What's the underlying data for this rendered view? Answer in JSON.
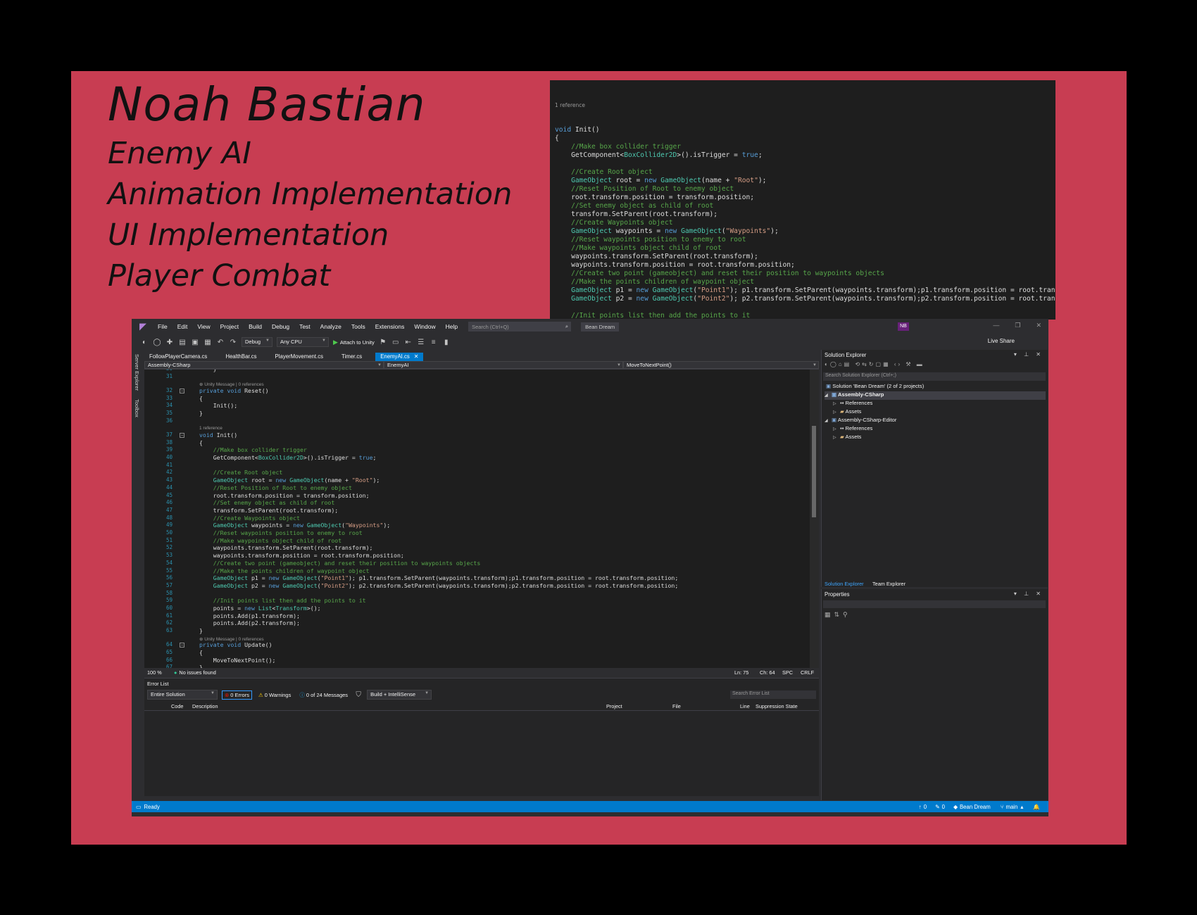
{
  "credits": {
    "name": "Noah Bastian",
    "roles": [
      "Enemy AI",
      "Animation Implementation",
      "UI Implementation",
      "Player Combat"
    ]
  },
  "code_panel": {
    "reference": "1 reference",
    "lines": [
      [
        [
          "k",
          "void"
        ],
        [
          "p",
          " Init()"
        ]
      ],
      [
        [
          "p",
          "{"
        ]
      ],
      [
        [
          "c",
          "    //Make box collider trigger"
        ]
      ],
      [
        [
          "p",
          "    GetComponent<"
        ],
        [
          "t",
          "BoxCollider2D"
        ],
        [
          "p",
          ">().isTrigger = "
        ],
        [
          "k",
          "true"
        ],
        [
          "p",
          ";"
        ]
      ],
      [
        [
          "p",
          ""
        ]
      ],
      [
        [
          "c",
          "    //Create Root object"
        ]
      ],
      [
        [
          "t",
          "    GameObject"
        ],
        [
          "p",
          " root = "
        ],
        [
          "k",
          "new"
        ],
        [
          "p",
          " "
        ],
        [
          "t",
          "GameObject"
        ],
        [
          "p",
          "(name + "
        ],
        [
          "s",
          "\"Root\""
        ],
        [
          "p",
          ");"
        ]
      ],
      [
        [
          "c",
          "    //Reset Position of Root to enemy object"
        ]
      ],
      [
        [
          "p",
          "    root.transform.position = transform.position;"
        ]
      ],
      [
        [
          "c",
          "    //Set enemy object as child of root"
        ]
      ],
      [
        [
          "p",
          "    transform.SetParent(root.transform);"
        ]
      ],
      [
        [
          "c",
          "    //Create Waypoints object"
        ]
      ],
      [
        [
          "t",
          "    GameObject"
        ],
        [
          "p",
          " waypoints = "
        ],
        [
          "k",
          "new"
        ],
        [
          "p",
          " "
        ],
        [
          "t",
          "GameObject"
        ],
        [
          "p",
          "("
        ],
        [
          "s",
          "\"Waypoints\""
        ],
        [
          "p",
          ");"
        ]
      ],
      [
        [
          "c",
          "    //Reset waypoints position to enemy to root"
        ]
      ],
      [
        [
          "c",
          "    //Make waypoints object child of root"
        ]
      ],
      [
        [
          "p",
          "    waypoints.transform.SetParent(root.transform);"
        ]
      ],
      [
        [
          "p",
          "    waypoints.transform.position = root.transform.position;"
        ]
      ],
      [
        [
          "c",
          "    //Create two point (gameobject) and reset their position to waypoints objects"
        ]
      ],
      [
        [
          "c",
          "    //Make the points children of waypoint object"
        ]
      ],
      [
        [
          "t",
          "    GameObject"
        ],
        [
          "p",
          " p1 = "
        ],
        [
          "k",
          "new"
        ],
        [
          "p",
          " "
        ],
        [
          "t",
          "GameObject"
        ],
        [
          "p",
          "("
        ],
        [
          "s",
          "\"Point1\""
        ],
        [
          "p",
          "); p1.transform.SetParent(waypoints.transform);p1.transform.position = root.transform.position;"
        ]
      ],
      [
        [
          "t",
          "    GameObject"
        ],
        [
          "p",
          " p2 = "
        ],
        [
          "k",
          "new"
        ],
        [
          "p",
          " "
        ],
        [
          "t",
          "GameObject"
        ],
        [
          "p",
          "("
        ],
        [
          "s",
          "\"Point2\""
        ],
        [
          "p",
          "); p2.transform.SetParent(waypoints.transform);p2.transform.position = root.transform.position;"
        ]
      ],
      [
        [
          "p",
          ""
        ]
      ],
      [
        [
          "c",
          "    //Init points list then add the points to it"
        ]
      ],
      [
        [
          "p",
          "    points = "
        ],
        [
          "k",
          "new"
        ],
        [
          "p",
          " "
        ],
        [
          "t",
          "List"
        ],
        [
          "p",
          "<"
        ],
        [
          "t",
          "Transform"
        ],
        [
          "p",
          ">();"
        ]
      ],
      [
        [
          "p",
          "    points.Add(p1.transform);"
        ]
      ],
      [
        [
          "p",
          "    points.Add(p2.transform);"
        ]
      ],
      [
        [
          "p",
          "}"
        ]
      ]
    ]
  },
  "vs": {
    "menu": [
      "File",
      "Edit",
      "View",
      "Project",
      "Build",
      "Debug",
      "Test",
      "Analyze",
      "Tools",
      "Extensions",
      "Window",
      "Help"
    ],
    "search_placeholder": "Search (Ctrl+Q)",
    "solution_name": "Bean Dream",
    "user_initials": "NB",
    "toolbar": {
      "config": "Debug",
      "platform": "Any CPU",
      "attach": "Attach to Unity",
      "live_share": "Live Share"
    },
    "side_tabs": [
      "Server Explorer",
      "Toolbox"
    ],
    "doc_tabs": [
      "FollowPlayerCamera.cs",
      "HealthBar.cs",
      "PlayerMovement.cs",
      "Timer.cs",
      "EnemyAI.cs"
    ],
    "nav": {
      "project": "Assembly-CSharp",
      "class": "EnemyAI",
      "member": "MoveToNextPoint()"
    },
    "editor_lines": [
      {
        "n": "30",
        "t": [
          [
            "p",
            "    }"
          ]
        ]
      },
      {
        "n": "31",
        "t": [
          [
            "p",
            ""
          ]
        ]
      },
      {
        "lens": "⊕ Unity Message | 0 references"
      },
      {
        "n": "32",
        "t": [
          [
            "k",
            "private"
          ],
          [
            "p",
            " "
          ],
          [
            "k",
            "void"
          ],
          [
            "p",
            " Reset()"
          ]
        ]
      },
      {
        "n": "33",
        "t": [
          [
            "p",
            "{"
          ]
        ]
      },
      {
        "n": "34",
        "t": [
          [
            "p",
            "    Init();"
          ]
        ]
      },
      {
        "n": "35",
        "t": [
          [
            "p",
            "}"
          ]
        ]
      },
      {
        "n": "36",
        "t": [
          [
            "p",
            ""
          ]
        ]
      },
      {
        "lens": "1 reference"
      },
      {
        "n": "37",
        "t": [
          [
            "k",
            "void"
          ],
          [
            "p",
            " Init()"
          ]
        ]
      },
      {
        "n": "38",
        "t": [
          [
            "p",
            "{"
          ]
        ]
      },
      {
        "n": "39",
        "t": [
          [
            "c",
            "    //Make box collider trigger"
          ]
        ]
      },
      {
        "n": "40",
        "t": [
          [
            "p",
            "    GetComponent<"
          ],
          [
            "t",
            "BoxCollider2D"
          ],
          [
            "p",
            ">().isTrigger = "
          ],
          [
            "k",
            "true"
          ],
          [
            "p",
            ";"
          ]
        ]
      },
      {
        "n": "41",
        "t": [
          [
            "p",
            ""
          ]
        ]
      },
      {
        "n": "42",
        "t": [
          [
            "c",
            "    //Create Root object"
          ]
        ]
      },
      {
        "n": "43",
        "t": [
          [
            "t",
            "    GameObject"
          ],
          [
            "p",
            " root = "
          ],
          [
            "k",
            "new"
          ],
          [
            "p",
            " "
          ],
          [
            "t",
            "GameObject"
          ],
          [
            "p",
            "(name + "
          ],
          [
            "s",
            "\"Root\""
          ],
          [
            "p",
            ");"
          ]
        ]
      },
      {
        "n": "44",
        "t": [
          [
            "c",
            "    //Reset Position of Root to enemy object"
          ]
        ]
      },
      {
        "n": "45",
        "t": [
          [
            "p",
            "    root.transform.position = transform.position;"
          ]
        ]
      },
      {
        "n": "46",
        "t": [
          [
            "c",
            "    //Set enemy object as child of root"
          ]
        ]
      },
      {
        "n": "47",
        "t": [
          [
            "p",
            "    transform.SetParent(root.transform);"
          ]
        ]
      },
      {
        "n": "48",
        "t": [
          [
            "c",
            "    //Create Waypoints object"
          ]
        ]
      },
      {
        "n": "49",
        "t": [
          [
            "t",
            "    GameObject"
          ],
          [
            "p",
            " waypoints = "
          ],
          [
            "k",
            "new"
          ],
          [
            "p",
            " "
          ],
          [
            "t",
            "GameObject"
          ],
          [
            "p",
            "("
          ],
          [
            "s",
            "\"Waypoints\""
          ],
          [
            "p",
            ");"
          ]
        ]
      },
      {
        "n": "50",
        "t": [
          [
            "c",
            "    //Reset waypoints position to enemy to root"
          ]
        ]
      },
      {
        "n": "51",
        "t": [
          [
            "c",
            "    //Make waypoints object child of root"
          ]
        ]
      },
      {
        "n": "52",
        "t": [
          [
            "p",
            "    waypoints.transform.SetParent(root.transform);"
          ]
        ]
      },
      {
        "n": "53",
        "t": [
          [
            "p",
            "    waypoints.transform.position = root.transform.position;"
          ]
        ]
      },
      {
        "n": "54",
        "t": [
          [
            "c",
            "    //Create two point (gameobject) and reset their position to waypoints objects"
          ]
        ]
      },
      {
        "n": "55",
        "t": [
          [
            "c",
            "    //Make the points children of waypoint object"
          ]
        ]
      },
      {
        "n": "56",
        "t": [
          [
            "t",
            "    GameObject"
          ],
          [
            "p",
            " p1 = "
          ],
          [
            "k",
            "new"
          ],
          [
            "p",
            " "
          ],
          [
            "t",
            "GameObject"
          ],
          [
            "p",
            "("
          ],
          [
            "s",
            "\"Point1\""
          ],
          [
            "p",
            "); p1.transform.SetParent(waypoints.transform);p1.transform.position = root.transform.position;"
          ]
        ]
      },
      {
        "n": "57",
        "t": [
          [
            "t",
            "    GameObject"
          ],
          [
            "p",
            " p2 = "
          ],
          [
            "k",
            "new"
          ],
          [
            "p",
            " "
          ],
          [
            "t",
            "GameObject"
          ],
          [
            "p",
            "("
          ],
          [
            "s",
            "\"Point2\""
          ],
          [
            "p",
            "); p2.transform.SetParent(waypoints.transform);p2.transform.position = root.transform.position;"
          ]
        ]
      },
      {
        "n": "58",
        "t": [
          [
            "p",
            ""
          ]
        ]
      },
      {
        "n": "59",
        "t": [
          [
            "c",
            "    //Init points list then add the points to it"
          ]
        ]
      },
      {
        "n": "60",
        "t": [
          [
            "p",
            "    points = "
          ],
          [
            "k",
            "new"
          ],
          [
            "p",
            " "
          ],
          [
            "t",
            "List"
          ],
          [
            "p",
            "<"
          ],
          [
            "t",
            "Transform"
          ],
          [
            "p",
            ">();"
          ]
        ]
      },
      {
        "n": "61",
        "t": [
          [
            "p",
            "    points.Add(p1.transform);"
          ]
        ]
      },
      {
        "n": "62",
        "t": [
          [
            "p",
            "    points.Add(p2.transform);"
          ]
        ]
      },
      {
        "n": "63",
        "t": [
          [
            "p",
            "}"
          ]
        ]
      },
      {
        "lens": "⊕ Unity Message | 0 references"
      },
      {
        "n": "64",
        "t": [
          [
            "k",
            "private"
          ],
          [
            "p",
            " "
          ],
          [
            "k",
            "void"
          ],
          [
            "p",
            " Update()"
          ]
        ]
      },
      {
        "n": "65",
        "t": [
          [
            "p",
            "{"
          ]
        ]
      },
      {
        "n": "66",
        "t": [
          [
            "p",
            "    MoveToNextPoint();"
          ]
        ]
      },
      {
        "n": "67",
        "t": [
          [
            "p",
            "}"
          ]
        ]
      },
      {
        "n": "68",
        "t": [
          [
            "p",
            ""
          ]
        ]
      },
      {
        "lens": "1 reference"
      },
      {
        "n": "69",
        "t": [
          [
            "k",
            "void"
          ],
          [
            "p",
            " MoveToNextPoint()"
          ]
        ]
      }
    ],
    "editor_status": {
      "zoom": "100 %",
      "issues": "No issues found",
      "ln": "Ln: 75",
      "ch": "Ch: 64",
      "spc": "SPC",
      "crlf": "CRLF"
    },
    "error_list": {
      "title": "Error List",
      "scope": "Entire Solution",
      "errors": "0 Errors",
      "warnings": "0 Warnings",
      "messages": "0 of 24 Messages",
      "build": "Build + IntelliSense",
      "search_placeholder": "Search Error List",
      "columns": [
        "Code",
        "Description",
        "Project",
        "File",
        "Line",
        "Suppression State"
      ]
    },
    "solution_explorer": {
      "title": "Solution Explorer",
      "search_placeholder": "Search Solution Explorer (Ctrl+;)",
      "solution": "Solution 'Bean Dream' (2 of 2 projects)",
      "projects": [
        {
          "name": "Assembly-CSharp",
          "children": [
            "References",
            "Assets"
          ]
        },
        {
          "name": "Assembly-CSharp-Editor",
          "children": [
            "References",
            "Assets"
          ]
        }
      ],
      "tabs": [
        "Solution Explorer",
        "Team Explorer"
      ]
    },
    "properties_title": "Properties",
    "statusbar": {
      "ready": "Ready",
      "up": "0",
      "pencil": "0",
      "repo": "Bean Dream",
      "branch": "main"
    }
  },
  "colors": {
    "slide_bg": "#c83d52",
    "accent": "#007acc",
    "keyword": "#569cd6",
    "type": "#4ec9b0",
    "comment": "#57a64a",
    "string": "#d69d85"
  }
}
